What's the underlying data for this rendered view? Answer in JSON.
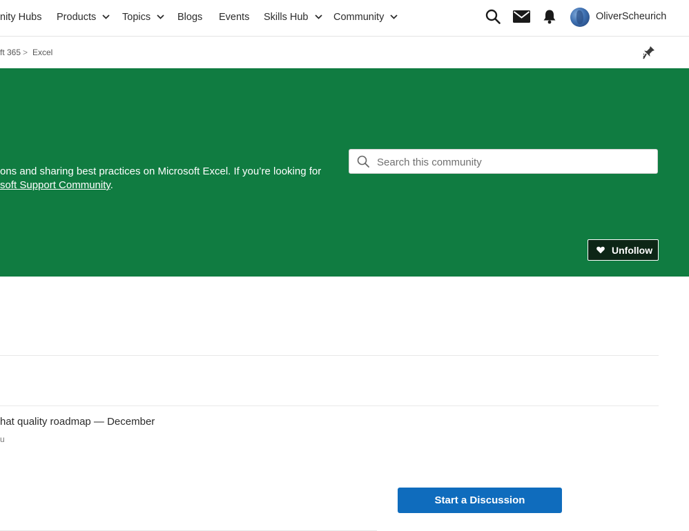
{
  "nav": {
    "items": [
      {
        "label": "nity Hubs",
        "has_chevron": false
      },
      {
        "label": "Products",
        "has_chevron": true
      },
      {
        "label": "Topics",
        "has_chevron": true
      },
      {
        "label": "Blogs",
        "has_chevron": false
      },
      {
        "label": "Events",
        "has_chevron": false
      },
      {
        "label": "Skills Hub",
        "has_chevron": true
      },
      {
        "label": "Community",
        "has_chevron": true
      }
    ],
    "icons": [
      "search-icon",
      "mail-icon",
      "bell-icon"
    ],
    "user": {
      "name": "OliverScheurich"
    }
  },
  "breadcrumb": {
    "items": [
      "ft 365",
      "Excel"
    ],
    "separator": ">",
    "action_icon": "pin-icon"
  },
  "banner": {
    "color": "#107c41",
    "description_line1": "ons and sharing best practices on Microsoft Excel. If you’re looking for",
    "description_link": "soft Support Community",
    "description_end": ".",
    "search_placeholder": "Search this community",
    "unfollow_label": "Unfollow"
  },
  "post": {
    "title": "hat quality roadmap — December",
    "author": "u"
  },
  "start_discussion_label": "Start a Discussion",
  "colors": {
    "accent": "#0f6cbd",
    "banner": "#107c41",
    "unfollow_bg": "#0d2616"
  }
}
